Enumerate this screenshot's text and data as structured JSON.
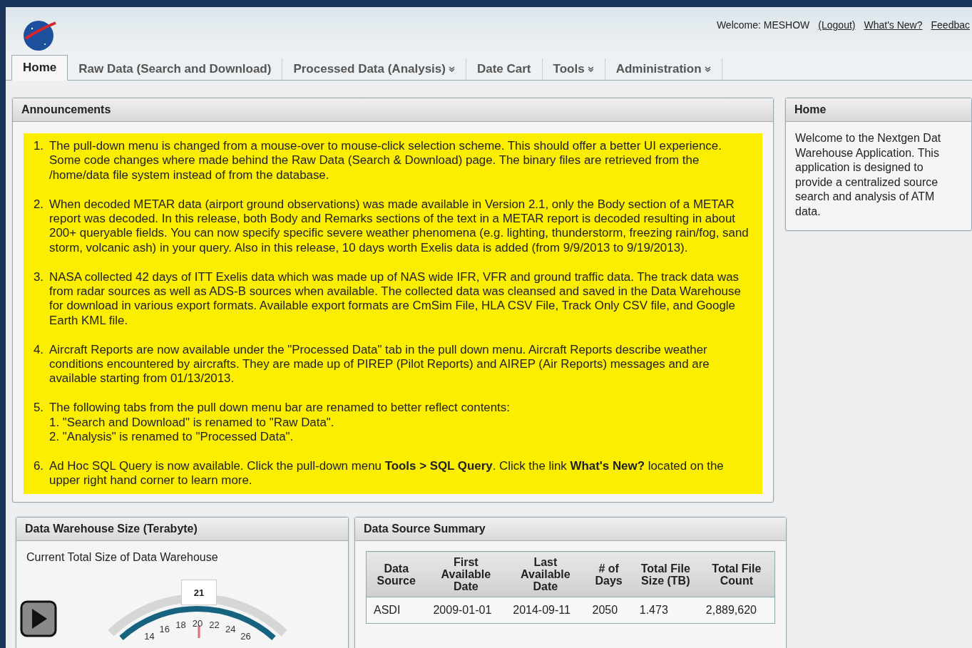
{
  "header": {
    "welcome": "Welcome: MESHOW",
    "links": [
      "(Logout)",
      "What's New?",
      "Feedbac"
    ]
  },
  "tabs": [
    {
      "label": "Home",
      "selected": true,
      "dropdown": false
    },
    {
      "label": "Raw Data (Search and Download)",
      "selected": false,
      "dropdown": false
    },
    {
      "label": "Processed Data (Analysis)",
      "selected": false,
      "dropdown": true
    },
    {
      "label": "Date Cart",
      "selected": false,
      "dropdown": false
    },
    {
      "label": "Tools",
      "selected": false,
      "dropdown": true
    },
    {
      "label": "Administration",
      "selected": false,
      "dropdown": true
    }
  ],
  "announcements": {
    "title": "Announcements",
    "items": [
      {
        "number": "1.",
        "text": "The pull-down menu is changed from a mouse-over to mouse-click selection scheme. This should offer a better UI experience. Some code changes where made behind the Raw Data (Search & Download) page. The binary files are retrieved from the /home/data file system instead of from the database."
      },
      {
        "number": "2.",
        "text": "When decoded METAR data (airport ground observations) was made available in Version 2.1, only the Body section of a METAR report was decoded. In this release, both Body and Remarks sections of the text in a METAR report is decoded resulting in about 200+ queryable fields. You can now specify specific severe weather phenomena (e.g. lighting, thunderstorm, freezing rain/fog, sand storm, volcanic ash) in your query. Also in this release, 10 days worth Exelis data is added (from 9/9/2013 to 9/19/2013)."
      },
      {
        "number": "3.",
        "text": "NASA collected 42 days of ITT Exelis data which was made up of NAS wide IFR, VFR and ground traffic data. The track data was from radar sources as well as ADS-B sources when available. The collected data was cleansed and saved in the Data Warehouse for download in various export formats. Available export formats are CmSim File, HLA CSV File, Track Only CSV file, and Google Earth KML file."
      },
      {
        "number": "4.",
        "text": "Aircraft Reports are now available under the \"Processed Data\" tab in the pull down menu. Aircraft Reports describe weather conditions encountered by aircrafts. They are made up of PIREP (Pilot Reports) and AIREP (Air Reports) messages and are available starting from 01/13/2013."
      },
      {
        "number": "5.",
        "text": "The following tabs from the pull down menu bar are renamed to better reflect contents:",
        "subitems": [
          "1. \"Search and Download\" is renamed to \"Raw Data\".",
          "2. \"Analysis\" is renamed to \"Processed Data\"."
        ]
      },
      {
        "number": "6.",
        "text": "Ad Hoc SQL Query is now available. Click the pull-down menu **Tools > SQL Query**. Click the link **What's New?** located on the upper right hand corner to learn more."
      }
    ]
  },
  "home_panel": {
    "title": "Home",
    "lines": [
      "Welcome to the Nextgen Dat",
      "Warehouse Application. This",
      "application is designed to",
      "provide a centralized source",
      "search and analysis of ATM",
      "data."
    ]
  },
  "size_panel": {
    "title": "Data Warehouse Size (Terabyte)",
    "subtitle": "Current Total Size of Data Warehouse",
    "gauge_value": "21",
    "gauge_ticks": [
      "14",
      "16",
      "18",
      "20",
      "22",
      "24",
      "26"
    ]
  },
  "summary_panel": {
    "title": "Data Source Summary",
    "columns": [
      "Data Source",
      "First Available Date",
      "Last Available Date",
      "# of Days",
      "Total File Size (TB)",
      "Total File Count"
    ],
    "rows": [
      [
        "ASDI",
        "2009-01-01",
        "2014-09-11",
        "2050",
        "1.473",
        "2,889,620"
      ]
    ]
  }
}
